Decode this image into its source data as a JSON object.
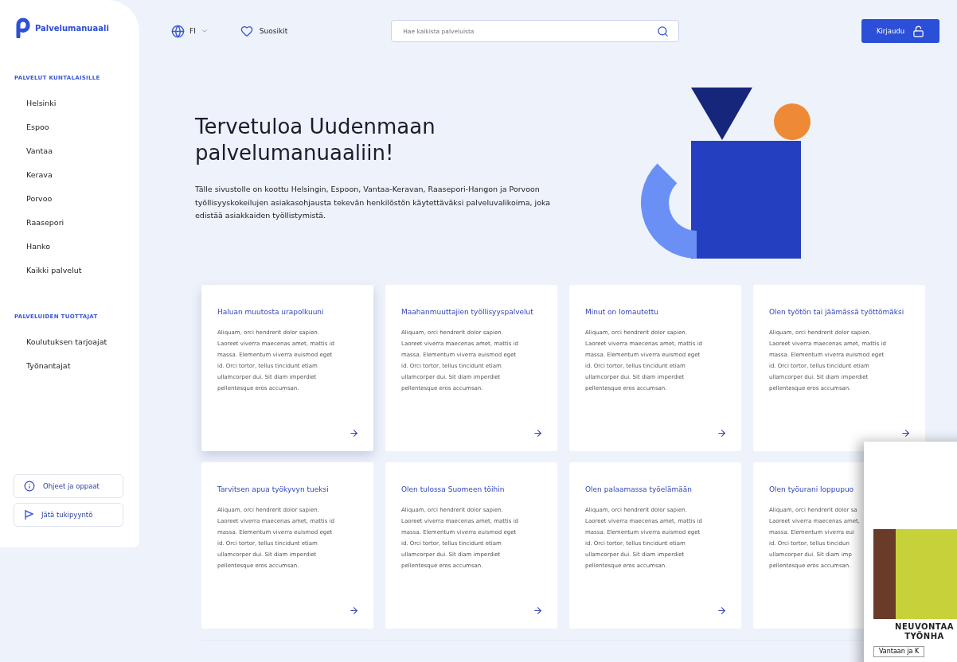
{
  "logo": {
    "text": "Palvelumanuaali"
  },
  "sidebar": {
    "sections": [
      {
        "title": "PALVELUT KUNTALAISILLE",
        "items": [
          "Helsinki",
          "Espoo",
          "Vantaa",
          "Kerava",
          "Porvoo",
          "Raasepori",
          "Hanko",
          "Kaikki palvelut"
        ]
      },
      {
        "title": "PALVELUIDEN TUOTTAJAT",
        "items": [
          "Koulutuksen tarjoajat",
          "Työnantajat"
        ]
      }
    ],
    "buttons": [
      {
        "kind": "info",
        "label": "Ohjeet ja oppaat"
      },
      {
        "kind": "flag",
        "label": "Jätä tukipyyntö"
      }
    ]
  },
  "header": {
    "language": "FI",
    "favorites": "Suosikit",
    "search": {
      "placeholder": "Hae kaikista palveluista"
    },
    "login": "Kirjaudu"
  },
  "hero": {
    "title": "Tervetuloa Uudenmaan palvelumanuaaliin!",
    "text": "Tälle sivustolle on koottu Helsingin, Espoon, Vantaa-Keravan, Raasepori-Hangon ja Porvoon työllisyyskokeilujen asiakasohjausta tekevän henkilöstön käytettäväksi palveluvalikoima, joka edistää asiakkaiden työllistymistä."
  },
  "cards": [
    {
      "title": "Haluan muutosta urapolkuuni",
      "hovered": true,
      "arrow": true,
      "body_lines": [
        "Aliquam, orci hendrerit dolor sapien.",
        "Laoreet viverra maecenas amet, mattis id",
        "massa. Elementum viverra euismod eget",
        "id. Orci tortor, tellus tincidunt etiam",
        "ullamcorper dui. Sit diam imperdiet",
        "pellentesque eros accumsan."
      ]
    },
    {
      "title": "Maahanmuuttajien työllisyyspalvelut",
      "hovered": false,
      "arrow": true,
      "body_lines": [
        "Aliquam, orci hendrerit dolor sapien.",
        "Laoreet viverra maecenas amet, mattis id",
        "massa. Elementum viverra euismod eget",
        "id. Orci tortor, tellus tincidunt etiam",
        "ullamcorper dui. Sit diam imperdiet",
        "pellentesque eros accumsan."
      ]
    },
    {
      "title": "Minut on lomautettu",
      "hovered": false,
      "arrow": true,
      "body_lines": [
        "Aliquam, orci hendrerit dolor sapien.",
        "Laoreet viverra maecenas amet, mattis id",
        "massa. Elementum viverra euismod eget",
        "id. Orci tortor, tellus tincidunt etiam",
        "ullamcorper dui. Sit diam imperdiet",
        "pellentesque eros accumsan."
      ]
    },
    {
      "title": "Olen työtön tai jäämässä työttömäksi",
      "hovered": false,
      "arrow": true,
      "body_lines": [
        "Aliquam, orci hendrerit dolor sapien.",
        "Laoreet viverra maecenas amet, mattis id",
        "massa. Elementum viverra euismod eget",
        "id. Orci tortor, tellus tincidunt etiam",
        "ullamcorper dui. Sit diam imperdiet",
        "pellentesque eros accumsan."
      ]
    },
    {
      "title": "Tarvitsen apua työkyvyn tueksi",
      "hovered": false,
      "arrow": true,
      "body_lines": [
        "Aliquam, orci hendrerit dolor sapien.",
        "Laoreet viverra maecenas amet, mattis id",
        "massa. Elementum viverra euismod eget",
        "id. Orci tortor, tellus tincidunt etiam",
        "ullamcorper dui. Sit diam imperdiet",
        "pellentesque eros accumsan."
      ]
    },
    {
      "title": "Olen tulossa Suomeen töihin",
      "hovered": false,
      "arrow": true,
      "body_lines": [
        "Aliquam, orci hendrerit dolor sapien.",
        "Laoreet viverra maecenas amet, mattis id",
        "massa. Elementum viverra euismod eget",
        "id. Orci tortor, tellus tincidunt etiam",
        "ullamcorper dui. Sit diam imperdiet",
        "pellentesque eros accumsan."
      ]
    },
    {
      "title": "Olen palaamassa työelämään",
      "hovered": false,
      "arrow": true,
      "body_lines": [
        "Aliquam, orci hendrerit dolor sapien.",
        "Laoreet viverra maecenas amet, mattis id",
        "massa. Elementum viverra euismod eget",
        "id. Orci tortor, tellus tincidunt etiam",
        "ullamcorper dui. Sit diam imperdiet",
        "pellentesque eros accumsan."
      ]
    },
    {
      "title": "Olen työurani loppupuo",
      "hovered": false,
      "arrow": false,
      "body_lines": [
        "Aliquam, orci hendrerit dolor sa",
        "Laoreet viverra maecenas amet,",
        "massa. Elementum viverra eui",
        "id. Orci tortor, tellus tincidun",
        "ullamcorper dui. Sit diam imp",
        "pellentesque eros accumsan."
      ]
    }
  ],
  "popup": {
    "heading_lines": [
      "NEUVONTAA",
      "TYÖNHA"
    ],
    "button": "Vantaan ja K"
  }
}
